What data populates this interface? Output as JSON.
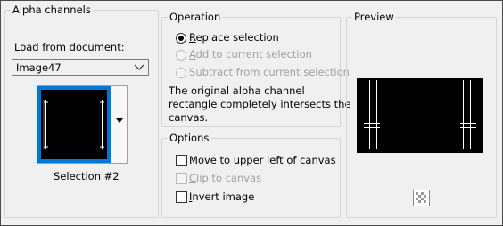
{
  "alpha": {
    "title": "Alpha channels",
    "load_label_pre": "Load from ",
    "load_label_key": "d",
    "load_label_post": "ocument:",
    "document_value": "Image47",
    "selection_caption": "Selection #2"
  },
  "operation": {
    "title": "Operation",
    "replace": {
      "key": "R",
      "rest": "eplace selection",
      "checked": true,
      "enabled": true
    },
    "add": {
      "key": "A",
      "rest": "dd to current selection",
      "checked": false,
      "enabled": false
    },
    "subtract": {
      "key": "S",
      "rest": "ubtract from current selection",
      "checked": false,
      "enabled": false
    },
    "message_lines": [
      "The original alpha channel",
      "rectangle completely intersects the",
      "canvas."
    ]
  },
  "options": {
    "title": "Options",
    "move": {
      "key": "M",
      "rest": "ove to upper left of canvas",
      "checked": false,
      "enabled": true
    },
    "clip": {
      "key": "C",
      "rest": "lip to canvas",
      "checked": false,
      "enabled": false
    },
    "invert": {
      "key": "I",
      "rest": "nvert image",
      "checked": false,
      "enabled": true
    }
  },
  "preview": {
    "title": "Preview",
    "zoom_icon": "checkerboard-zoom-icon"
  },
  "colors": {
    "selection_highlight": "#0078d7",
    "disabled_text": "#a0a0a0",
    "background": "#f0f0f0"
  }
}
